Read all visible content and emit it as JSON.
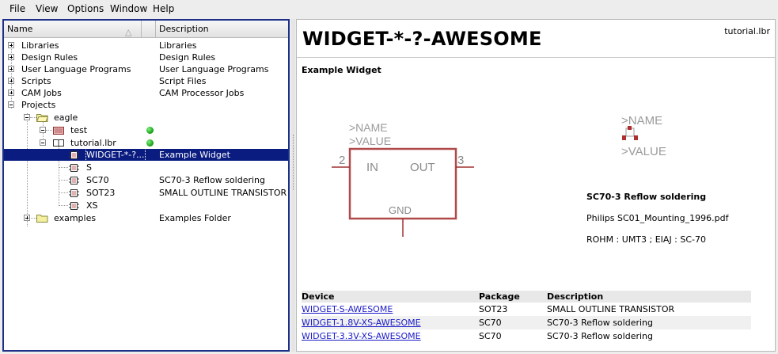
{
  "menubar": {
    "file": "File",
    "view": "View",
    "options": "Options",
    "window": "Window",
    "help": "Help"
  },
  "tree": {
    "col_name": "Name",
    "col_desc": "Description",
    "rows": [
      {
        "name": "Libraries",
        "desc": "Libraries"
      },
      {
        "name": "Design Rules",
        "desc": "Design Rules"
      },
      {
        "name": "User Language Programs",
        "desc": "User Language Programs"
      },
      {
        "name": "Scripts",
        "desc": "Script Files"
      },
      {
        "name": "CAM Jobs",
        "desc": "CAM Processor Jobs"
      },
      {
        "name": "Projects",
        "desc": ""
      },
      {
        "name": "eagle",
        "desc": ""
      },
      {
        "name": "test",
        "desc": ""
      },
      {
        "name": "tutorial.lbr",
        "desc": ""
      },
      {
        "name": "WIDGET-*-?...",
        "desc": "Example Widget"
      },
      {
        "name": "S",
        "desc": ""
      },
      {
        "name": "SC70",
        "desc": "SC70-3 Reflow soldering"
      },
      {
        "name": "SOT23",
        "desc": "SMALL OUTLINE TRANSISTOR"
      },
      {
        "name": "XS",
        "desc": ""
      },
      {
        "name": "examples",
        "desc": "Examples Folder"
      }
    ]
  },
  "preview": {
    "title": "WIDGET-*-?-AWESOME",
    "file": "tutorial.lbr",
    "subtitle": "Example Widget",
    "symbol": {
      "name": ">NAME",
      "value": ">VALUE",
      "pin_in": "IN",
      "pin_out": "OUT",
      "pin_gnd": "GND",
      "pin_num_left": "2",
      "pin_num_right": "3"
    },
    "package": {
      "name": ">NAME",
      "value": ">VALUE",
      "title": "SC70-3 Reflow soldering",
      "ref": "Philips SC01_Mounting_1996.pdf",
      "note": "ROHM : UMT3 ; EIAJ : SC-70"
    },
    "devices": {
      "headers": [
        "Device",
        "Package",
        "Description"
      ],
      "rows": [
        {
          "device": "WIDGET-S-AWESOME",
          "package": "SOT23",
          "description": "SMALL OUTLINE TRANSISTOR"
        },
        {
          "device": "WIDGET-1.8V-XS-AWESOME",
          "package": "SC70",
          "description": "SC70-3 Reflow soldering"
        },
        {
          "device": "WIDGET-3.3V-XS-AWESOME",
          "package": "SC70",
          "description": "SC70-3 Reflow soldering"
        }
      ]
    }
  },
  "colors": {
    "selection": "#0b1c80",
    "symbol": "#b04a4a",
    "pin": "#a03030",
    "link": "#1a1ac8",
    "status_ok": "#22b822"
  }
}
